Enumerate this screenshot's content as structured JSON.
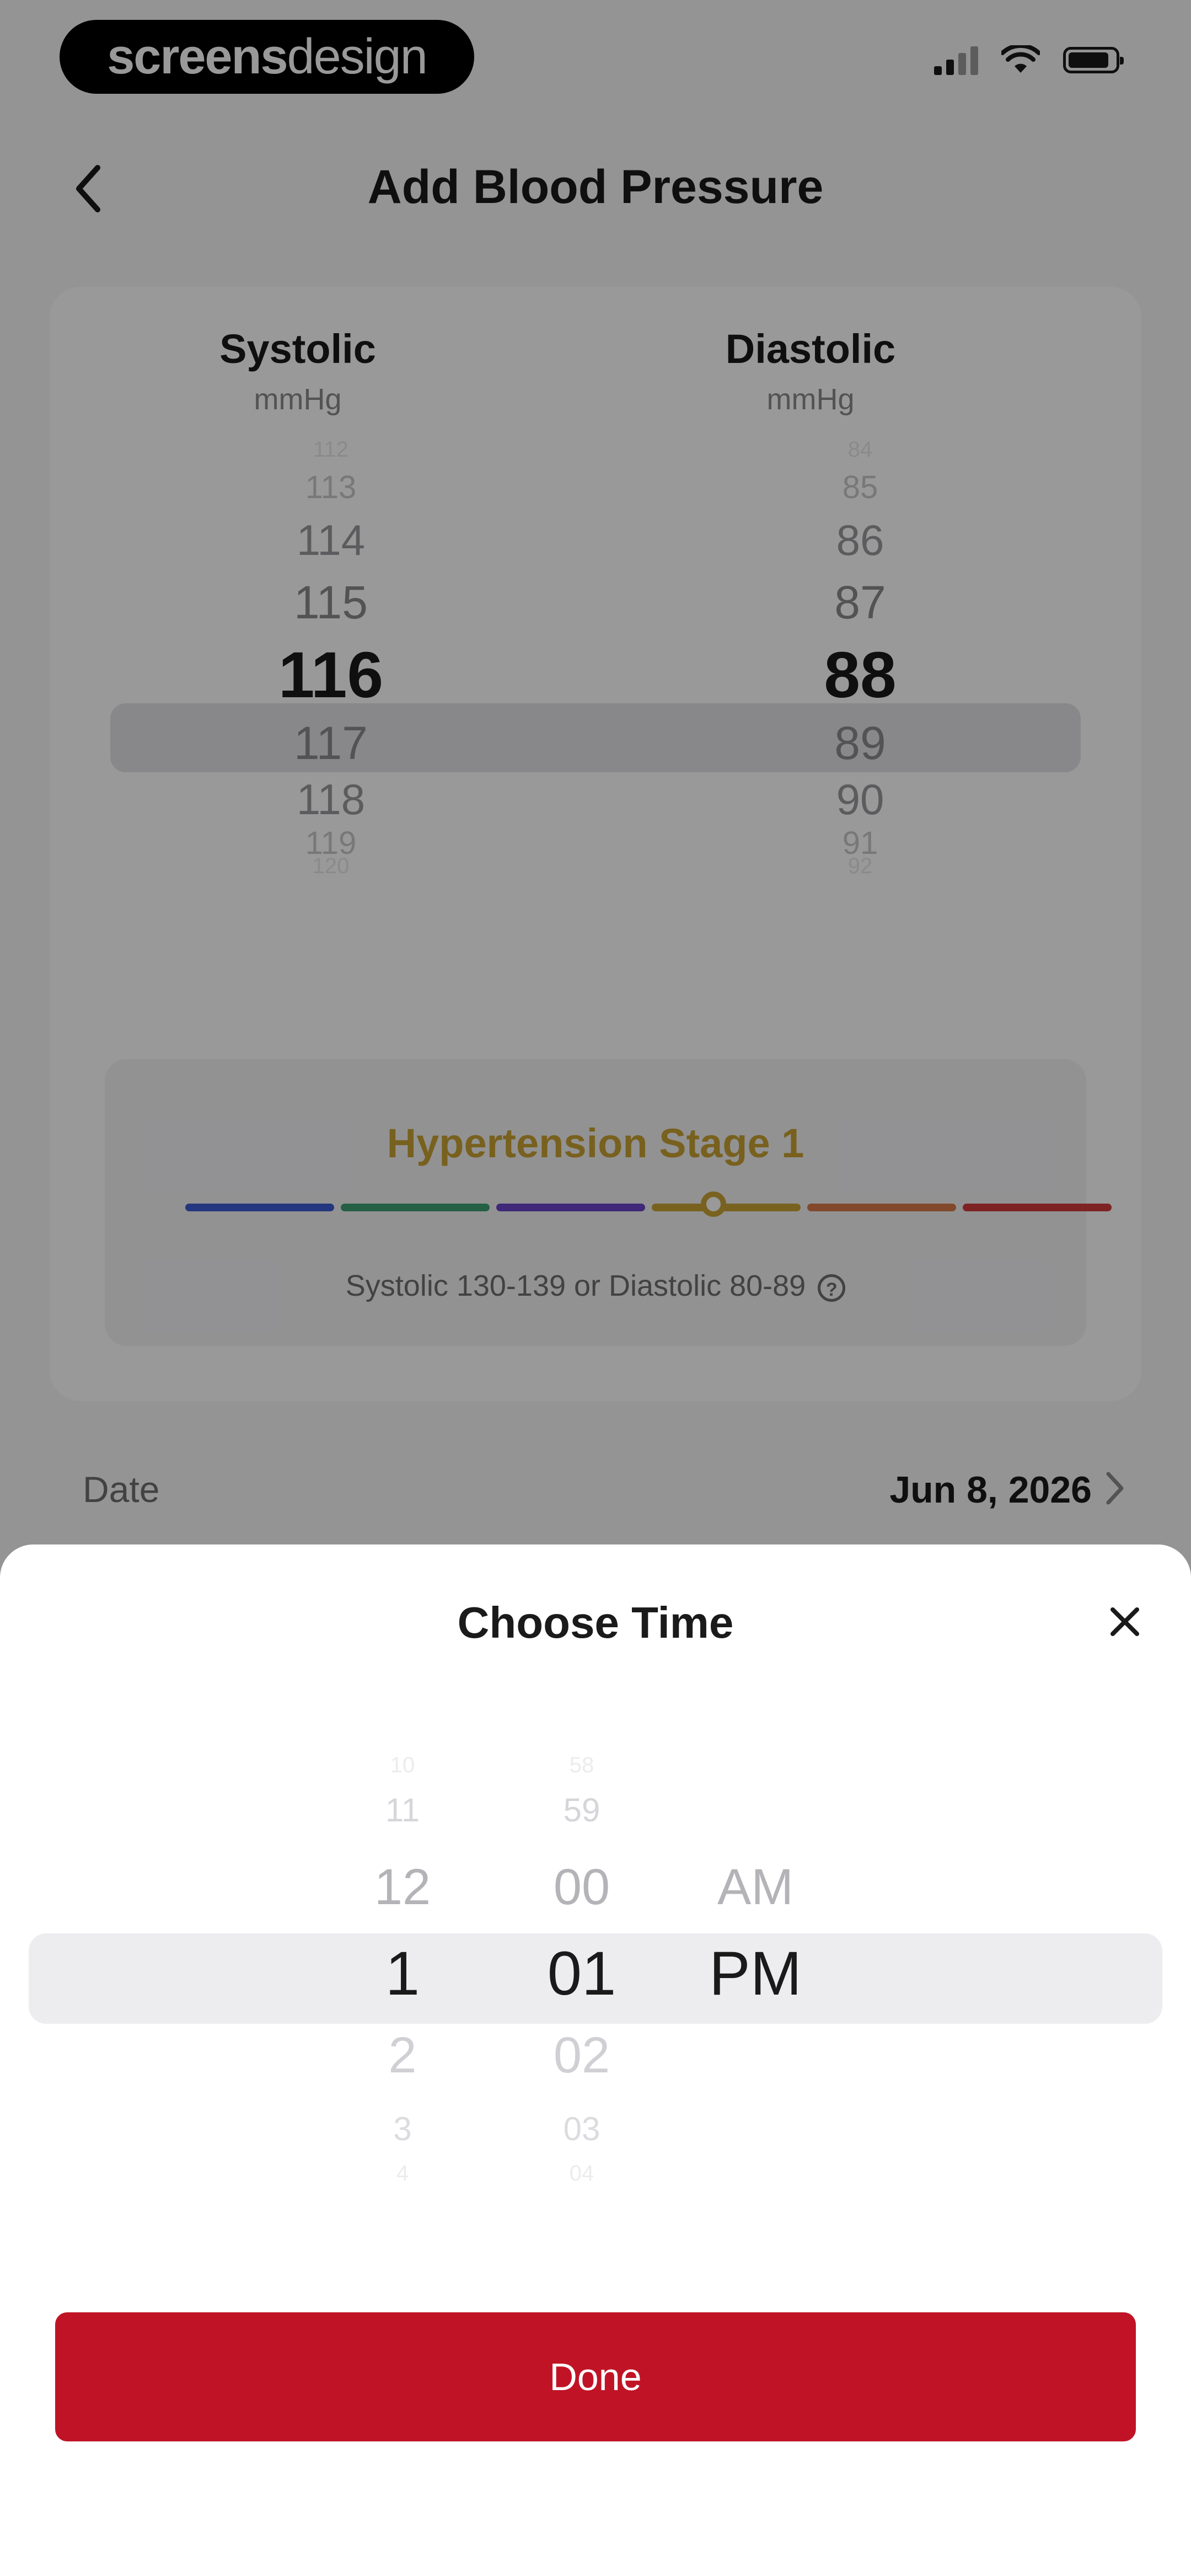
{
  "status_bar": {
    "brand_bold": "screens",
    "brand_light": "design"
  },
  "header": {
    "title": "Add Blood Pressure"
  },
  "reading": {
    "systolic": {
      "label": "Systolic",
      "unit": "mmHg",
      "values": [
        "112",
        "113",
        "114",
        "115",
        "116",
        "117",
        "118",
        "119",
        "120"
      ],
      "selected": "116"
    },
    "diastolic": {
      "label": "Diastolic",
      "unit": "mmHg",
      "values": [
        "84",
        "85",
        "86",
        "87",
        "88",
        "89",
        "90",
        "91",
        "92"
      ],
      "selected": "88"
    }
  },
  "classification": {
    "title": "Hypertension Stage 1",
    "description": "Systolic 130-139 or Diastolic 80-89",
    "scale_position_fraction": 0.57,
    "colors": {
      "title": "#c9a233",
      "segments": [
        "#3d5bd1",
        "#3fa073",
        "#6a45c9",
        "#caa436",
        "#d97a4a",
        "#d23b3b"
      ]
    }
  },
  "date_row": {
    "label": "Date",
    "value": "Jun 8, 2026"
  },
  "time_sheet": {
    "title": "Choose Time",
    "hours": [
      "10",
      "11",
      "12",
      "1",
      "2",
      "3",
      "4"
    ],
    "minutes": [
      "58",
      "59",
      "00",
      "01",
      "02",
      "03",
      "04"
    ],
    "periods": [
      "AM",
      "PM"
    ],
    "selected_hour": "1",
    "selected_minute": "01",
    "selected_period": "PM",
    "done_label": "Done"
  },
  "colors": {
    "accent": "#c01426"
  }
}
